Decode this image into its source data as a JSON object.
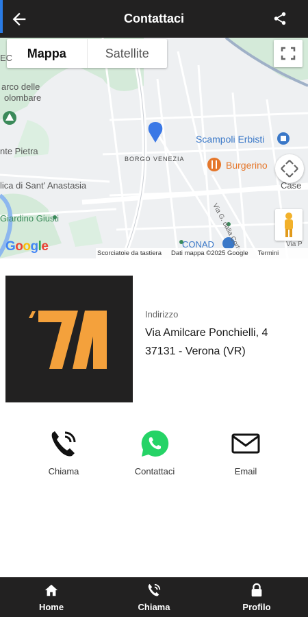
{
  "header": {
    "title": "Contattaci",
    "back_icon": "arrow-left-icon",
    "share_icon": "share-icon"
  },
  "map": {
    "type_control": {
      "map_label": "Mappa",
      "satellite_label": "Satellite",
      "selected": "Mappa"
    },
    "labels": {
      "parco": "arco delle",
      "parco2": "olombare",
      "pietra": "nte Pietra",
      "anastasia": "lica di Sant' Anastasia",
      "giusti": "Giardino Giusti",
      "borgo": "BORGO VENEZIA",
      "scampoli": "Scampoli Erbisti",
      "burgerino": "Burgerino",
      "casera": "Case",
      "via_corte": "Via G. dalla Corte",
      "conad": "CONAD",
      "via_p": "Via P",
      "ec": "EC"
    },
    "google_logo": "Google",
    "attribution": {
      "shortcuts": "Scorciatoie da tastiera",
      "data": "Dati mappa ©2025 Google",
      "terms": "Termini"
    }
  },
  "business": {
    "logo_text": "‘71",
    "address_label": "Indirizzo",
    "address_line1": "Via Amilcare Ponchielli, 4",
    "address_line2": "37131 - Verona (VR)"
  },
  "actions": [
    {
      "label": "Chiama",
      "icon": "phone-icon"
    },
    {
      "label": "Contattaci",
      "icon": "whatsapp-icon"
    },
    {
      "label": "Email",
      "icon": "mail-icon"
    }
  ],
  "bottom_nav": [
    {
      "label": "Home",
      "icon": "home-icon"
    },
    {
      "label": "Chiama",
      "icon": "phone-icon"
    },
    {
      "label": "Profilo",
      "icon": "lock-icon"
    }
  ],
  "colors": {
    "bar": "#222121",
    "logo_orange": "#f4a13c",
    "whatsapp": "#25d366",
    "map_pin": "#3a78e6"
  }
}
